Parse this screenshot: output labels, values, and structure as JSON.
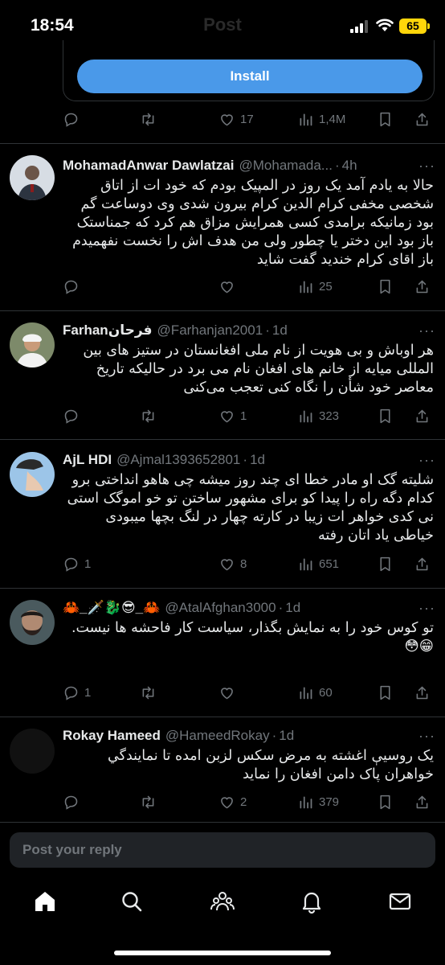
{
  "status_bar": {
    "time": "18:54",
    "battery": "65",
    "ghost_title": "Post"
  },
  "ad": {
    "install_label": "Install",
    "reply_count": "",
    "like_count": "17",
    "view_count": "1,4M"
  },
  "tweets": [
    {
      "name": "MohamadAnwar Dawlatzai",
      "handle": "@Mohamada...",
      "time": "4h",
      "text": "حالا به یادم آمد یک روز در المپیک بودم که خود ات از اتاق شخصی مخفی کرام الدین کرام بیرون شدی وی دوساعت گم بود زمانیکه برامدی کسی همرایش مزاق هم کرد که جمناستک باز بود این دختر یا چطور ولی من هدف اش را نخست نفهمیدم باز اقای کرام خندید گفت شاید",
      "replies": "",
      "reposts": "",
      "likes": "",
      "views": "25"
    },
    {
      "name": "Farhanفرحان",
      "handle": "@Farhanjan2001",
      "time": "1d",
      "text": "هر اوباش و بی هویت از نام ملی افغانستان در ستیز های بین المللی میایه از خانم های افغان نام می برد در حالیکه تاریخ معاصر خود شأن را نگاه کنی تعجب می‌کنی",
      "replies": "",
      "reposts": "",
      "likes": "1",
      "views": "323"
    },
    {
      "name": "AjL HDI",
      "handle": "@Ajmal1393652801",
      "time": "1d",
      "text": "شلیته گک او مادر خطا ای چند روز میشه چی هاهو انداختی برو کدام دگه راه را پیدا کو برای مشهور ساختن تو خو اموگک استی نی کدی خواهر ات زیبا در کارته چهار در لنگ بچها میبودی خیاطی یاد اتان رفته",
      "replies": "1",
      "reposts": "",
      "likes": "8",
      "views": "651"
    },
    {
      "name": "🦀_🗡️🐉😎_🦀",
      "handle": "@AtalAfghan3000",
      "time": "1d",
      "text": "تو کوس خود را به نمایش بگذار، سیاست کار فاحشه ها نیست.\n😁😳",
      "replies": "1",
      "reposts": "",
      "likes": "",
      "views": "60"
    },
    {
      "name": "Rokay Hameed",
      "handle": "@HameedRokay",
      "time": "1d",
      "text": "يک روسيې اغشته به مرض سکس لزبن امده تا نمايندگي خواهران پاک دامن افغان را نمايد",
      "replies": "",
      "reposts": "",
      "likes": "2",
      "views": "379"
    }
  ],
  "reply_box": {
    "placeholder": "Post your reply"
  },
  "nav": {
    "items": [
      "home-icon",
      "search-icon",
      "communities-icon",
      "notifications-icon",
      "messages-icon"
    ]
  },
  "colors": {
    "accent": "#4a99e9",
    "muted": "#71767b",
    "battery": "#ffd60a"
  }
}
